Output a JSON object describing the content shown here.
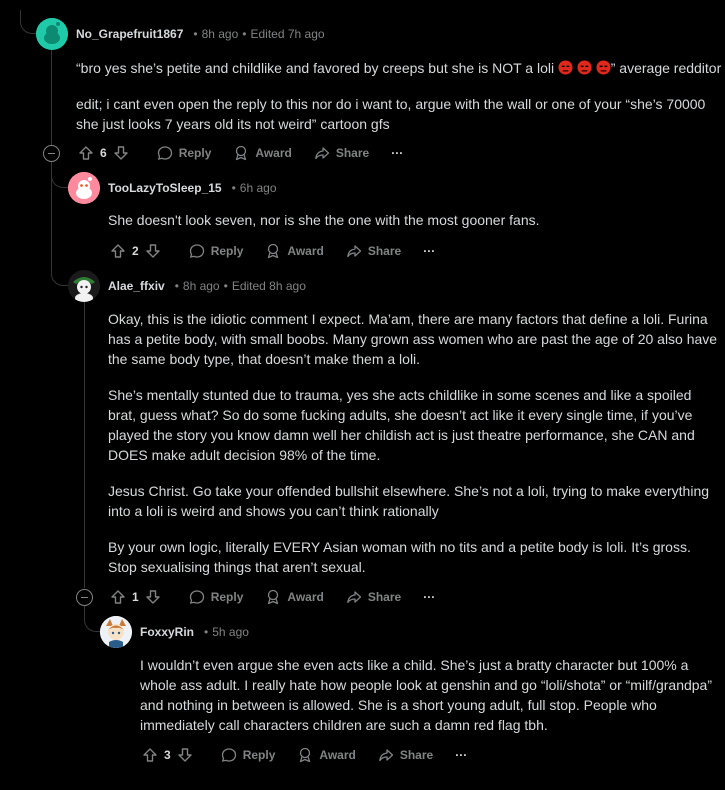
{
  "colors": {
    "background": "#000000",
    "text": "#d7dadc",
    "muted": "#818384",
    "thread_line": "#343536",
    "emoji_red": "#e0281c"
  },
  "comments": [
    {
      "username": "No_Grapefruit1867",
      "time": "8h ago",
      "edited": "Edited 7h ago",
      "avatar": "snoo-teal-avatar",
      "paragraphs": [
        "“bro yes she’s petite and childlike and favored by creeps but she is NOT a loli",
        "” average redditor",
        "edit; i cant even open the reply to this nor do i want to, argue with the wall or one of your “she’s 70000 she just looks 7 years old its not weird” cartoon gfs"
      ],
      "emoji": [
        "angry-face-icon",
        "angry-face-icon",
        "angry-face-icon"
      ],
      "score": "6",
      "reply": "Reply",
      "award": "Award",
      "share": "Share",
      "more": "···"
    },
    {
      "username": "TooLazyToSleep_15",
      "time": "6h ago",
      "avatar": "snoo-pink-avatar",
      "paragraphs": [
        "She doesn't look seven, nor is she the one with the most gooner fans."
      ],
      "score": "2",
      "reply": "Reply",
      "award": "Award",
      "share": "Share",
      "more": "···"
    },
    {
      "username": "Alae_ffxiv",
      "time": "8h ago",
      "edited": "Edited 8h ago",
      "avatar": "snoo-green-avatar",
      "paragraphs": [
        "Okay, this is the idiotic comment I expect. Ma’am, there are many factors that define a loli. Furina has a petite body, with small boobs. Many grown ass women who are past the age of 20 also have the same body type, that doesn’t make them a loli.",
        "She’s mentally stunted due to trauma, yes she acts childlike in some scenes and like a spoiled brat, guess what? So do some fucking adults, she doesn’t act like it every single time, if you’ve played the story you know damn well her childish act is just theatre performance, she CAN and DOES make adult decision 98% of the time.",
        "Jesus Christ. Go take your offended bullshit elsewhere. She’s not a loli, trying to make everything into a loli is weird and shows you can’t think rationally",
        "By your own logic, literally EVERY Asian woman with no tits and a petite body is loli. It’s gross. Stop sexualising things that aren’t sexual."
      ],
      "score": "1",
      "reply": "Reply",
      "award": "Award",
      "share": "Share",
      "more": "···"
    },
    {
      "username": "FoxxyRin",
      "time": "5h ago",
      "avatar": "fox-character-avatar",
      "paragraphs": [
        "I wouldn’t even argue she even acts like a child. She’s just a bratty character but 100% a whole ass adult. I really hate how people look at genshin and go “loli/shota” or “milf/grandpa” and nothing in between is allowed. She is a short young adult, full stop. People who immediately call characters children are such a damn red flag tbh."
      ],
      "score": "3",
      "reply": "Reply",
      "award": "Award",
      "share": "Share",
      "more": "···"
    }
  ]
}
